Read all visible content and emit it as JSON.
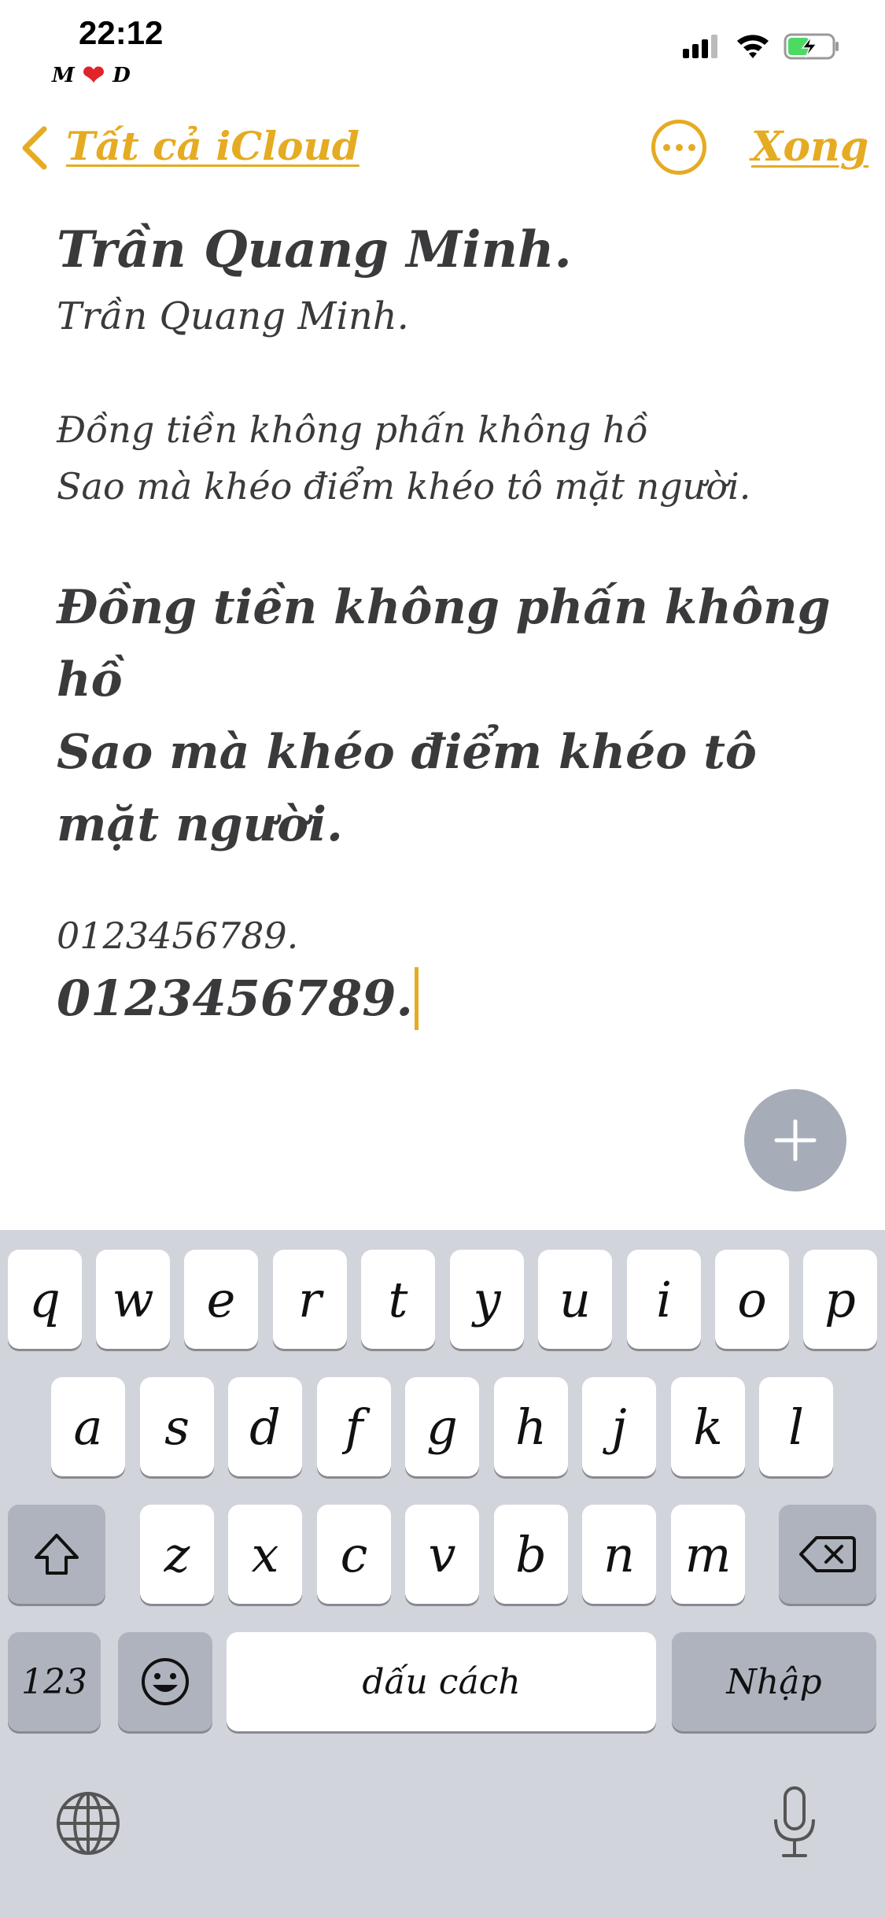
{
  "status_bar": {
    "time": "22:12",
    "carrier_left": "M",
    "carrier_heart": "❤",
    "carrier_right": "D",
    "battery_state": "charging",
    "accent_green": "#4cd964"
  },
  "nav": {
    "back_label": "Tất cả iCloud",
    "done_label": "Xong",
    "accent_color": "#e5ab22"
  },
  "note": {
    "title_bold": "Trần Quang Minh.",
    "title_regular": "Trần Quang Minh.",
    "poem_small_line1": "Đồng tiền không phấn không hồ",
    "poem_small_line2": "Sao mà khéo điểm khéo tô mặt người.",
    "poem_large_line1": "Đồng tiền không phấn không hồ",
    "poem_large_line2": "Sao mà khéo điểm khéo tô mặt người.",
    "number_small": "0123456789.",
    "number_large": "0123456789."
  },
  "keyboard": {
    "row1": [
      "q",
      "w",
      "e",
      "r",
      "t",
      "y",
      "u",
      "i",
      "o",
      "p"
    ],
    "row2": [
      "a",
      "s",
      "d",
      "f",
      "g",
      "h",
      "j",
      "k",
      "l"
    ],
    "row3": [
      "z",
      "x",
      "c",
      "v",
      "b",
      "n",
      "m"
    ],
    "numbers_key": "123",
    "space_label": "dấu cách",
    "return_label": "Nhập",
    "icons": [
      "shift-icon",
      "delete-icon",
      "emoji-icon",
      "globe-icon",
      "microphone-icon"
    ]
  }
}
